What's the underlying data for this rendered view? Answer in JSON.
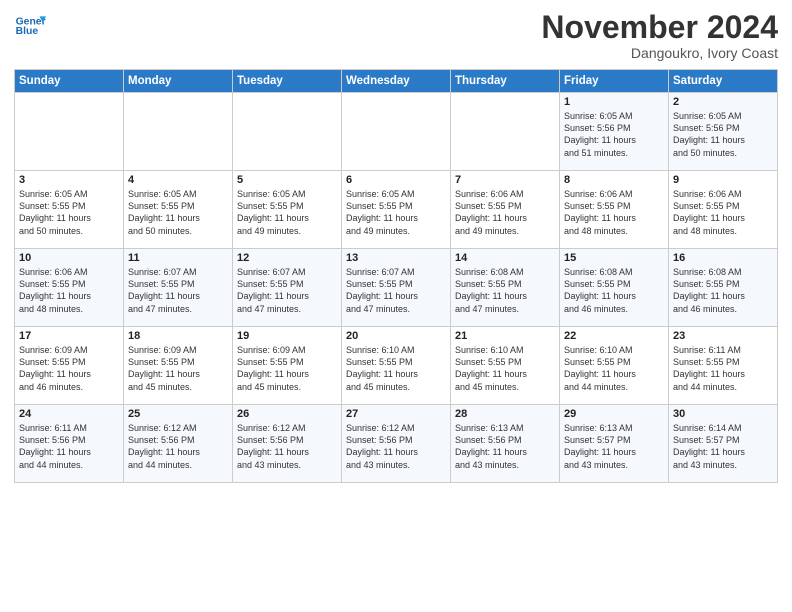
{
  "header": {
    "logo_line1": "General",
    "logo_line2": "Blue",
    "month": "November 2024",
    "location": "Dangoukro, Ivory Coast"
  },
  "weekdays": [
    "Sunday",
    "Monday",
    "Tuesday",
    "Wednesday",
    "Thursday",
    "Friday",
    "Saturday"
  ],
  "weeks": [
    [
      {
        "day": "",
        "info": ""
      },
      {
        "day": "",
        "info": ""
      },
      {
        "day": "",
        "info": ""
      },
      {
        "day": "",
        "info": ""
      },
      {
        "day": "",
        "info": ""
      },
      {
        "day": "1",
        "info": "Sunrise: 6:05 AM\nSunset: 5:56 PM\nDaylight: 11 hours\nand 51 minutes."
      },
      {
        "day": "2",
        "info": "Sunrise: 6:05 AM\nSunset: 5:56 PM\nDaylight: 11 hours\nand 50 minutes."
      }
    ],
    [
      {
        "day": "3",
        "info": "Sunrise: 6:05 AM\nSunset: 5:55 PM\nDaylight: 11 hours\nand 50 minutes."
      },
      {
        "day": "4",
        "info": "Sunrise: 6:05 AM\nSunset: 5:55 PM\nDaylight: 11 hours\nand 50 minutes."
      },
      {
        "day": "5",
        "info": "Sunrise: 6:05 AM\nSunset: 5:55 PM\nDaylight: 11 hours\nand 49 minutes."
      },
      {
        "day": "6",
        "info": "Sunrise: 6:05 AM\nSunset: 5:55 PM\nDaylight: 11 hours\nand 49 minutes."
      },
      {
        "day": "7",
        "info": "Sunrise: 6:06 AM\nSunset: 5:55 PM\nDaylight: 11 hours\nand 49 minutes."
      },
      {
        "day": "8",
        "info": "Sunrise: 6:06 AM\nSunset: 5:55 PM\nDaylight: 11 hours\nand 48 minutes."
      },
      {
        "day": "9",
        "info": "Sunrise: 6:06 AM\nSunset: 5:55 PM\nDaylight: 11 hours\nand 48 minutes."
      }
    ],
    [
      {
        "day": "10",
        "info": "Sunrise: 6:06 AM\nSunset: 5:55 PM\nDaylight: 11 hours\nand 48 minutes."
      },
      {
        "day": "11",
        "info": "Sunrise: 6:07 AM\nSunset: 5:55 PM\nDaylight: 11 hours\nand 47 minutes."
      },
      {
        "day": "12",
        "info": "Sunrise: 6:07 AM\nSunset: 5:55 PM\nDaylight: 11 hours\nand 47 minutes."
      },
      {
        "day": "13",
        "info": "Sunrise: 6:07 AM\nSunset: 5:55 PM\nDaylight: 11 hours\nand 47 minutes."
      },
      {
        "day": "14",
        "info": "Sunrise: 6:08 AM\nSunset: 5:55 PM\nDaylight: 11 hours\nand 47 minutes."
      },
      {
        "day": "15",
        "info": "Sunrise: 6:08 AM\nSunset: 5:55 PM\nDaylight: 11 hours\nand 46 minutes."
      },
      {
        "day": "16",
        "info": "Sunrise: 6:08 AM\nSunset: 5:55 PM\nDaylight: 11 hours\nand 46 minutes."
      }
    ],
    [
      {
        "day": "17",
        "info": "Sunrise: 6:09 AM\nSunset: 5:55 PM\nDaylight: 11 hours\nand 46 minutes."
      },
      {
        "day": "18",
        "info": "Sunrise: 6:09 AM\nSunset: 5:55 PM\nDaylight: 11 hours\nand 45 minutes."
      },
      {
        "day": "19",
        "info": "Sunrise: 6:09 AM\nSunset: 5:55 PM\nDaylight: 11 hours\nand 45 minutes."
      },
      {
        "day": "20",
        "info": "Sunrise: 6:10 AM\nSunset: 5:55 PM\nDaylight: 11 hours\nand 45 minutes."
      },
      {
        "day": "21",
        "info": "Sunrise: 6:10 AM\nSunset: 5:55 PM\nDaylight: 11 hours\nand 45 minutes."
      },
      {
        "day": "22",
        "info": "Sunrise: 6:10 AM\nSunset: 5:55 PM\nDaylight: 11 hours\nand 44 minutes."
      },
      {
        "day": "23",
        "info": "Sunrise: 6:11 AM\nSunset: 5:55 PM\nDaylight: 11 hours\nand 44 minutes."
      }
    ],
    [
      {
        "day": "24",
        "info": "Sunrise: 6:11 AM\nSunset: 5:56 PM\nDaylight: 11 hours\nand 44 minutes."
      },
      {
        "day": "25",
        "info": "Sunrise: 6:12 AM\nSunset: 5:56 PM\nDaylight: 11 hours\nand 44 minutes."
      },
      {
        "day": "26",
        "info": "Sunrise: 6:12 AM\nSunset: 5:56 PM\nDaylight: 11 hours\nand 43 minutes."
      },
      {
        "day": "27",
        "info": "Sunrise: 6:12 AM\nSunset: 5:56 PM\nDaylight: 11 hours\nand 43 minutes."
      },
      {
        "day": "28",
        "info": "Sunrise: 6:13 AM\nSunset: 5:56 PM\nDaylight: 11 hours\nand 43 minutes."
      },
      {
        "day": "29",
        "info": "Sunrise: 6:13 AM\nSunset: 5:57 PM\nDaylight: 11 hours\nand 43 minutes."
      },
      {
        "day": "30",
        "info": "Sunrise: 6:14 AM\nSunset: 5:57 PM\nDaylight: 11 hours\nand 43 minutes."
      }
    ]
  ]
}
